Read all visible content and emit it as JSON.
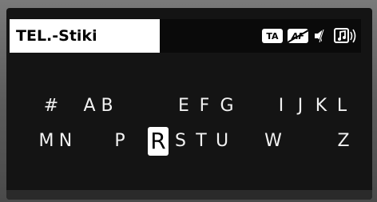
{
  "header": {
    "title": "TEL.-Stiki",
    "ta_label": "TA",
    "af_label": "AF",
    "icons": [
      "ta-badge",
      "af-disabled-badge",
      "mute-icon",
      "music-speaker-icon"
    ]
  },
  "keyboard": {
    "row1": [
      {
        "label": "#",
        "name": "key-hash"
      },
      {
        "label": "A",
        "name": "key-a"
      },
      {
        "label": "B",
        "name": "key-b"
      },
      {
        "label": "E",
        "name": "key-e"
      },
      {
        "label": "F",
        "name": "key-f"
      },
      {
        "label": "G",
        "name": "key-g"
      },
      {
        "label": "I",
        "name": "key-i"
      },
      {
        "label": "J",
        "name": "key-j"
      },
      {
        "label": "K",
        "name": "key-k"
      },
      {
        "label": "L",
        "name": "key-l"
      }
    ],
    "row2": [
      {
        "label": "M",
        "name": "key-m"
      },
      {
        "label": "N",
        "name": "key-n"
      },
      {
        "label": "P",
        "name": "key-p"
      },
      {
        "label": "R",
        "name": "key-r",
        "selected": true
      },
      {
        "label": "S",
        "name": "key-s"
      },
      {
        "label": "T",
        "name": "key-t"
      },
      {
        "label": "U",
        "name": "key-u"
      },
      {
        "label": "W",
        "name": "key-w"
      },
      {
        "label": "Z",
        "name": "key-z"
      }
    ],
    "selected_key": "R"
  },
  "colors": {
    "screen_bg": "#141414",
    "text": "#f2f2f2",
    "highlight_bg": "#ffffff",
    "highlight_text": "#000000"
  }
}
